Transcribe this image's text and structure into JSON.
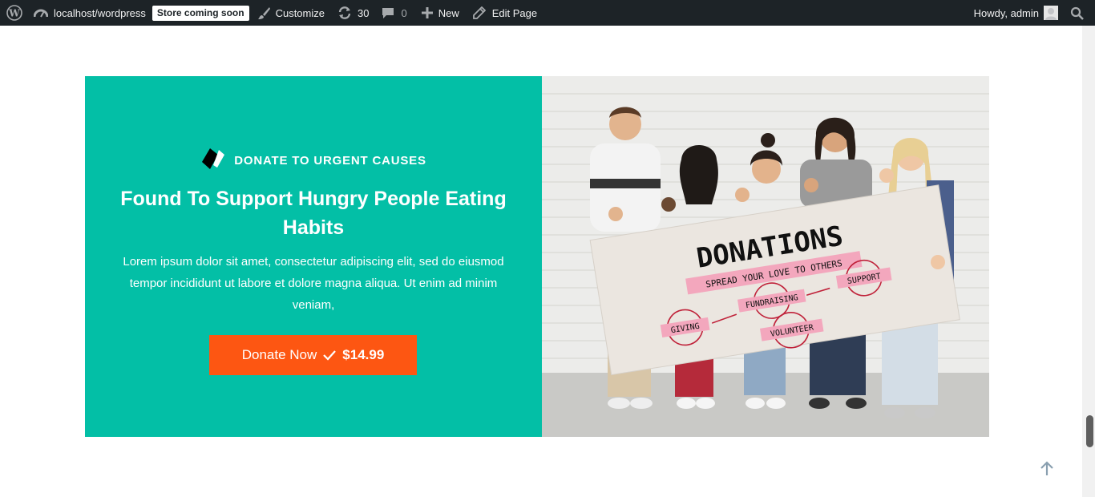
{
  "admin_bar": {
    "site_name": "localhost/wordpress",
    "store_badge": "Store coming soon",
    "customize": "Customize",
    "updates_count": "30",
    "comments_count": "0",
    "new": "New",
    "edit_page": "Edit Page",
    "greeting": "Howdy, admin"
  },
  "cta": {
    "eyebrow": "DONATE TO URGENT CAUSES",
    "headline": "Found To Support Hungry People Eating Habits",
    "body": "Lorem ipsum dolor sit amet, consectetur adipiscing elit, sed do eiusmod tempor incididunt ut labore et dolore magna aliqua. Ut enim ad minim veniam,",
    "button_label": "Donate Now",
    "button_price": "$14.99"
  },
  "photo": {
    "sign_title": "DONATIONS",
    "sign_subtitle": "SPREAD YOUR LOVE TO OTHERS",
    "sign_words": [
      "GIVING",
      "FUNDRAISING",
      "SUPPORT",
      "VOLUNTEER"
    ]
  },
  "colors": {
    "admin_bar": "#1d2327",
    "teal": "#03bfa6",
    "orange": "#fd5612"
  },
  "icons": {
    "wordpress": "wordpress-logo-icon",
    "dashboard": "dashboard-icon",
    "customize": "paintbrush-icon",
    "updates": "refresh-icon",
    "comments": "comment-icon",
    "new": "plus-icon",
    "edit": "pencil-icon",
    "search": "search-icon",
    "back_to_top": "arrow-up-icon"
  }
}
